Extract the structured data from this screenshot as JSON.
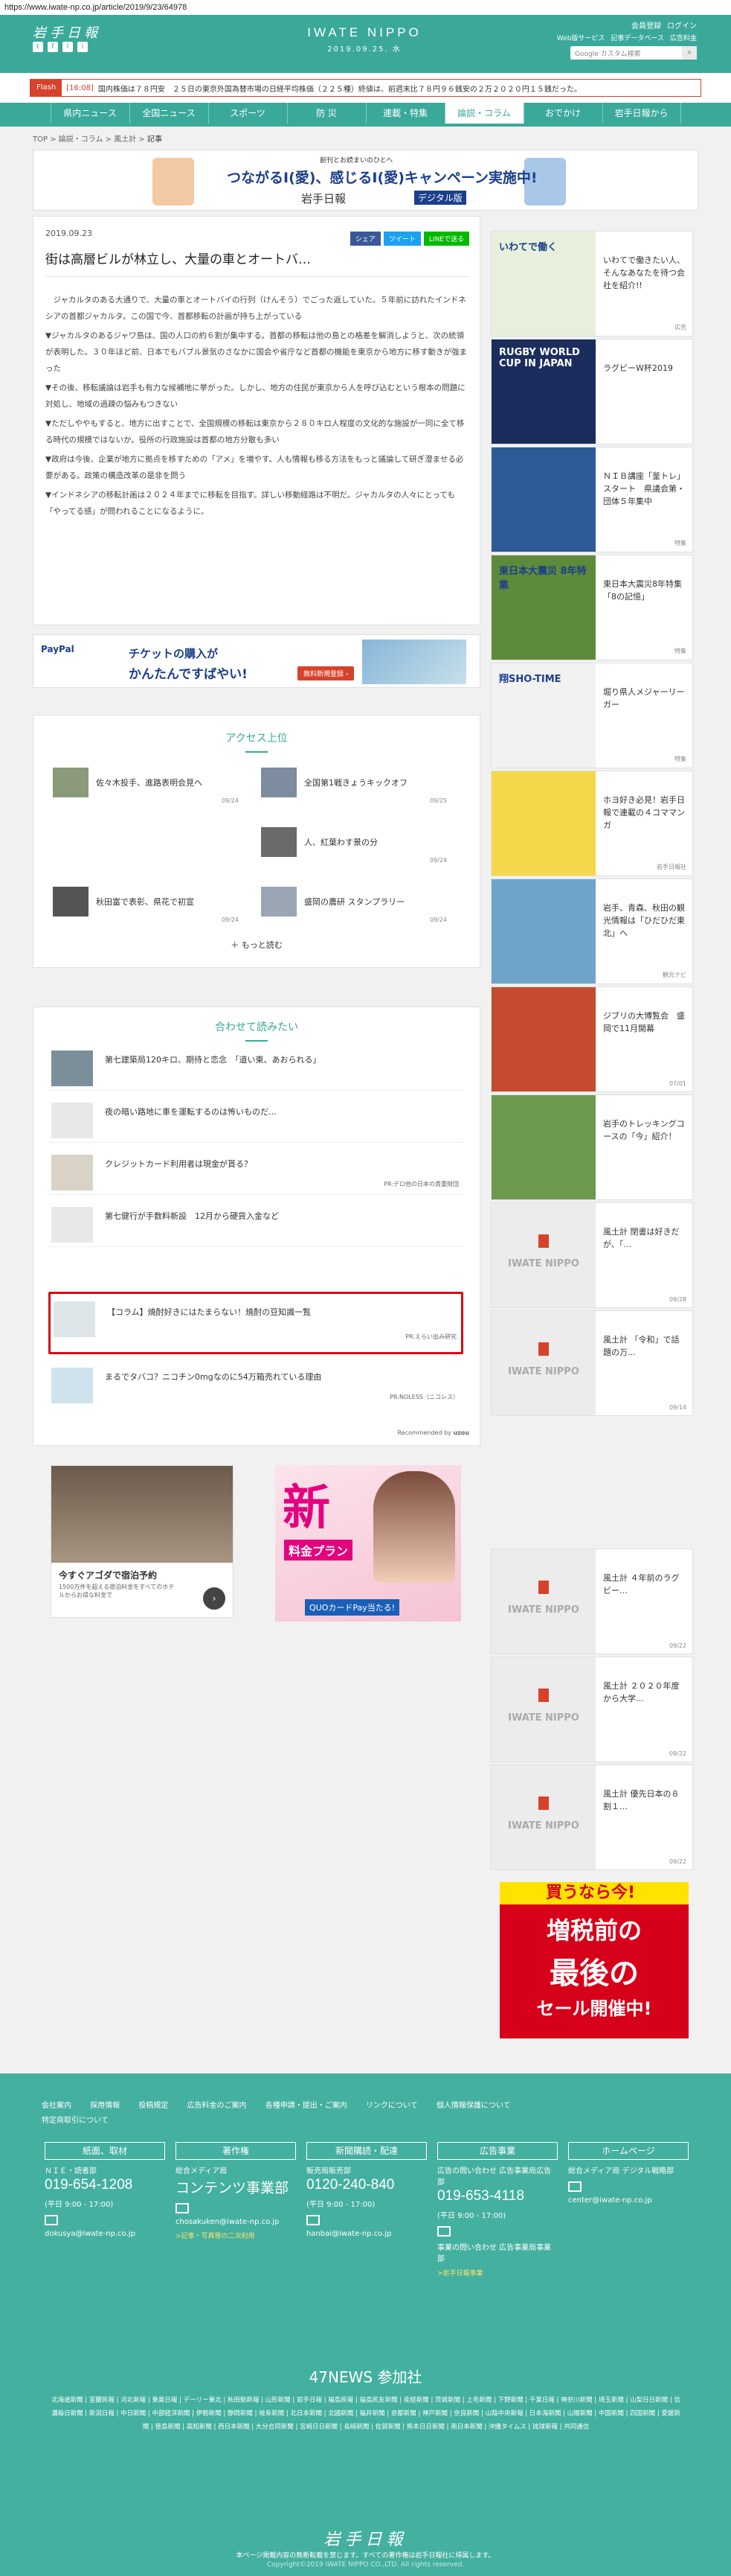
{
  "url": "https://www.iwate-np.co.jp/article/2019/9/23/64978",
  "header": {
    "logo_jp": "岩手日報",
    "social": [
      "t",
      "f",
      "l",
      "i"
    ],
    "brand_en": "IWATE NIPPO",
    "date": "2019.09.25. 水",
    "member": "会員登録",
    "login": "ログイン",
    "sublinks": [
      "Web版サービス",
      "記事データベース",
      "広告料金"
    ],
    "search_placeholder": "Google カスタム検索",
    "search_icon": "search-icon"
  },
  "flash": {
    "tag": "Flash",
    "time": "[16:08]",
    "text": "国内株価は７８円安　２５日の東京外国為替市場の日経平均株価（２２５種）終値は、前週末比７８円９６銭安の２万２０２０円１５銭だった。"
  },
  "nav": [
    "県内ニュース",
    "全国ニュース",
    "スポーツ",
    "防 災",
    "連載・特集",
    "論説・コラム",
    "おでかけ",
    "岩手日報から"
  ],
  "nav_active": 5,
  "breadcrumb": [
    "TOP",
    "論説・コラム",
    "風土計",
    "記事"
  ],
  "banner1": {
    "small": "創刊とお読まいのひとへ",
    "main": "つながるI(愛)、感じるI(愛)キャンペーン実施中!",
    "sub": "岩手日報",
    "digital": "デジタル版"
  },
  "article": {
    "date": "2019.09.23",
    "title": "街は高層ビルが林立し、大量の車とオートバ…",
    "share": [
      "シェア",
      "ツイート",
      "LINEで送る"
    ],
    "paragraphs": [
      "　ジャカルタのある大通りで、大量の車とオートバイの行列（けんそう）でごった返していた。５年前に訪れたインドネシアの首都ジャカルタ。この国で今、首都移転の計画が持ち上がっている",
      "▼ジャカルタのあるジャワ島は、国の人口の約６割が集中する。首都の移転は他の島との格差を解消しようと、次の統領が表明した。３０年ほど前、日本でもバブル景気のさなかに国会や省庁など首都の機能を東京から地方に移す動きが強まった",
      "▼その後、移転議論は岩手も有力な候補地に挙がった。しかし、地方の住民が東京から人を呼び込むという根本の問題に対処し、地域の過疎の悩みもつきない",
      "▼ただしややもすると、地方に出すことで、全国規模の移転は東京から２８０キロ人程度の文化的な施設が一同に全て移る時代の規模ではないか。役所の行政施設は首都の地方分散も多い",
      "▼政府は今後、企業が地方に拠点を移すための「アメ」を増やす。人も情報も移る方法をもっと議論して研ぎ澄ませる必要がある。政策の構造改革の是非を問う",
      "▼インドネシアの移転計画は２０２４年までに移転を目指す。詳しい移動経路は不明だ。ジャカルタの人々にとっても「やってる感」が問われることになるように。"
    ]
  },
  "ad_paypal": {
    "brand": "PayPal",
    "line1": "チケットの購入が",
    "line2": "かんたんですばやい!",
    "btn": "無料新規登録 ›"
  },
  "access": {
    "heading": "アクセス上位",
    "items": [
      {
        "title": "佐々木投手、進路表明会見へ",
        "date": "09/24"
      },
      {
        "title": "全国第1戦きょうキックオフ",
        "date": "09/25"
      },
      {
        "title": "",
        "date": ""
      },
      {
        "title": "人、紅葉わす景の分",
        "date": "09/24"
      },
      {
        "title": "秋田富で表彰、県花で初宣",
        "date": "09/24"
      },
      {
        "title": "盛岡の農研 スタンプラリー",
        "date": "09/24"
      }
    ],
    "more": "もっと読む"
  },
  "related": {
    "heading": "合わせて読みたい",
    "items": [
      {
        "title": "第七建築局120キロ、期待と恋念　「道い東、あおられる」",
        "pr": ""
      },
      {
        "title": "夜の暗い路地に車を運転するのは怖いものだ…",
        "pr": ""
      },
      {
        "title": "クレジットカード利用者は現金が貰る？",
        "pr": "PR:デロ他の日本の貴重財団"
      },
      {
        "title": "第七健行が手数料新設　12月から硬貨入金など",
        "pr": ""
      },
      {
        "title": "【コラム】焼酎好きにはたまらない！焼酎の豆知識一覧",
        "pr": "PR:えらい出み研究"
      },
      {
        "title": "まるでタバコ？ニコチン0mgなのに54万箱売れている理由",
        "pr": "PR:NOLESS（ニコレス）"
      }
    ],
    "by": "Recommended by",
    "by_brand": "uzou"
  },
  "ad_agoda": {
    "t1": "今すぐアゴダで宿泊予約",
    "t2": "1500万件を超える宿泊料金をすべてのホテルからお得な料金で"
  },
  "ad_pink": {
    "big": "新",
    "red": "料金プラン",
    "blue": "QUOカードPay当たる!"
  },
  "side": [
    {
      "title": "いわてで働きたい人、そんなあなたを待つ会社を紹介!!",
      "cat": "広告",
      "thumb": "いわてで働く",
      "kind": "green"
    },
    {
      "title": "ラグビーW杯2019",
      "cat": "",
      "thumb": "RUGBY WORLD CUP IN JAPAN",
      "kind": "dark"
    },
    {
      "title": "ＮＩＢ講座「釜トレ」スタート　県議会第・団体５年集中",
      "cat": "特集",
      "thumb": "",
      "kind": "poster"
    },
    {
      "title": "東日本大震災8年特集「8の記憶」",
      "cat": "特集",
      "thumb": "東日本大震災 8年特集",
      "kind": "coast"
    },
    {
      "title": "堀り県人メジャーリーガー",
      "cat": "特集",
      "thumb": "翔SHO-TIME",
      "kind": "baseball"
    },
    {
      "title": "ホヨ好き必見！岩手日報で連載の４コママンガ",
      "cat": "岩手日報社",
      "thumb": "",
      "kind": "comic"
    },
    {
      "title": "岩手、青森、秋田の観光情報は「ひだひだ東北」へ",
      "cat": "観光ナビ",
      "thumb": "",
      "kind": "lake"
    },
    {
      "title": "ジブリの大博覧会　盛岡で11月開幕",
      "cat": "07/01",
      "thumb": "",
      "kind": "ghibli"
    },
    {
      "title": "岩手のトレッキングコースの「今」紹介！",
      "cat": "",
      "thumb": "",
      "kind": "mountain"
    },
    {
      "title": "風土計 閉書は好きだが、「…",
      "cat": "09/28",
      "thumb": "IWATE NIPPO",
      "kind": "logo"
    },
    {
      "title": "風土計 「令和」で話題の万…",
      "cat": "09/14",
      "thumb": "IWATE NIPPO",
      "kind": "logo"
    },
    {
      "title": "風土計 ４年前のラグビー…",
      "cat": "09/22",
      "thumb": "IWATE NIPPO",
      "kind": "logo"
    },
    {
      "title": "風土計 ２０２０年度から大学…",
      "cat": "09/22",
      "thumb": "IWATE NIPPO",
      "kind": "logo"
    },
    {
      "title": "風土計 優先日本の８割１…",
      "cat": "09/22",
      "thumb": "IWATE NIPPO",
      "kind": "logo"
    }
  ],
  "sale": {
    "top": "買うなら今!",
    "l1": "増税前の",
    "l2": "最後の",
    "l3": "セール開催中!"
  },
  "footer": {
    "links": [
      "会社案内",
      "採用情報",
      "投稿規定",
      "広告料金のご案内",
      "各種申請・提出・ご案内",
      "リンクについて",
      "個人情報保護について",
      "特定商取引について"
    ],
    "cols": [
      {
        "h": "紙面、取材",
        "r1": "ＮＩＥ・読者部",
        "tel": "019-654-1208",
        "hours": "(平日 9:00 - 17:00)",
        "mail": "dokusya@iwate-np.co.jp",
        "yel": ""
      },
      {
        "h": "著作権",
        "r1": "総合メディア局",
        "tel": "コンテンツ事業部",
        "hours": "",
        "mail": "chosakuken@iwate-np.co.jp",
        "yel": ">記事・写真等の二次利用"
      },
      {
        "h": "新聞購読・配達",
        "r1": "販売局販売部",
        "tel": "0120-240-840",
        "hours": "(平日 9:00 - 17:00)",
        "mail": "hanbai@iwate-np.co.jp",
        "yel": ""
      },
      {
        "h": "広告事業",
        "r1": "広告の問い合わせ 広告事業局広告部",
        "tel": "019-653-4118",
        "hours": "(平日 9:00 - 17:00)",
        "mail": "事業の問い合わせ 広告事業局事業部",
        "yel": ">岩手日報事業"
      },
      {
        "h": "ホームページ",
        "r1": "総合メディア局 デジタル戦略部",
        "tel": "",
        "hours": "",
        "mail": "center@iwate-np.co.jp",
        "yel": ""
      }
    ],
    "n47": "47NEWS 参加社",
    "n47list": "北海道新聞 | 室蘭民報 | 河北新報 | 東奥日報 | デーリー東北 | 秋田魁新報 | 山形新聞 | 岩手日報 | 福島民報 | 福島民友新聞 | 産経新聞 | 茨城新聞 | 上毛新聞 | 下野新聞 | 千葉日報 | 神奈川新聞 | 埼玉新聞 | 山梨日日新聞 | 信濃毎日新聞 | 新潟日報 | 中日新聞 | 中部経済新聞 | 伊勢新聞 | 静岡新聞 | 岐阜新聞 | 北日本新聞 | 北國新聞 | 福井新聞 | 京都新聞 | 神戸新聞 | 奈良新聞 | 山陰中央新報 | 日本海新聞 | 山陽新聞 | 中国新聞 | 四国新聞 | 愛媛新聞 | 徳島新聞 | 高知新聞 | 西日本新聞 | 大分合同新聞 | 宮崎日日新聞 | 長崎新聞 | 佐賀新聞 | 熊本日日新聞 | 南日本新聞 | 沖縄タイムス | 琉球新報 | 共同通信",
    "logo": "岩手日報",
    "note": "本ページ掲載内容の無断転載を禁じます。すべての著作権は岩手日報社に帰属します。",
    "copy": "Copyright©2019 IWATE NIPPO CO.,LTD. All rights reserved."
  }
}
